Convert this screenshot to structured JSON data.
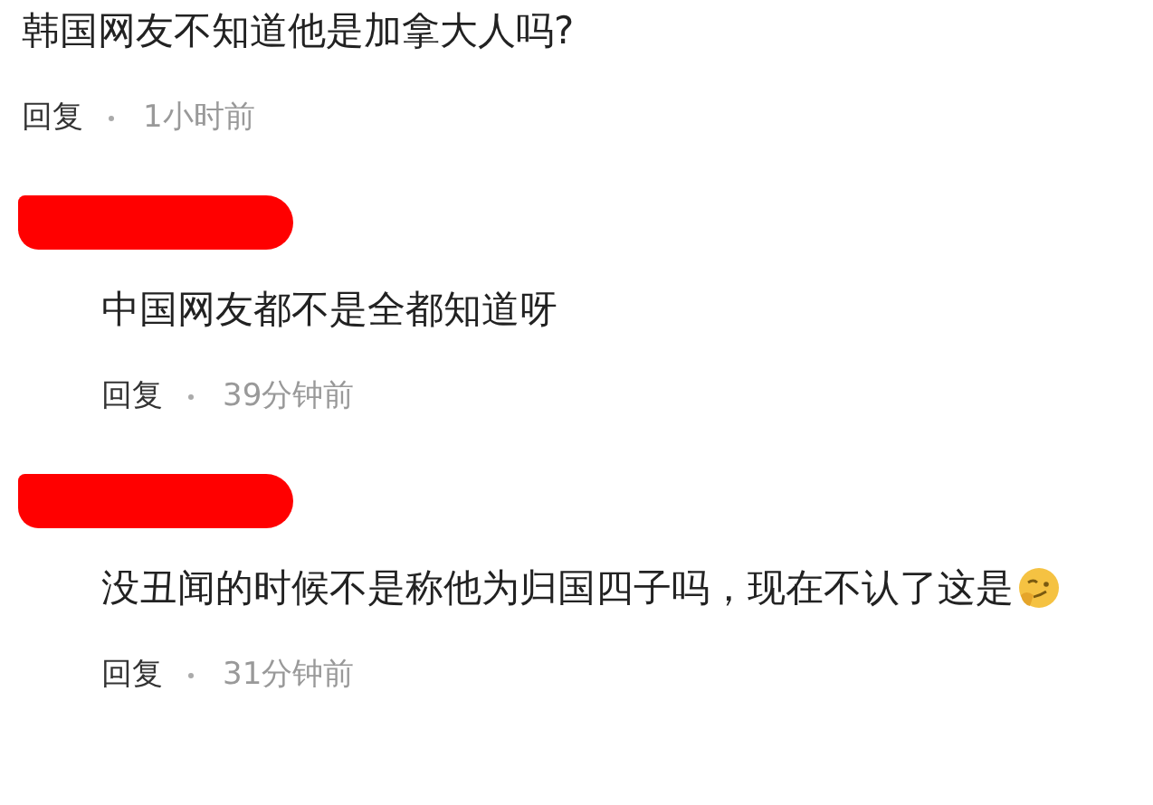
{
  "comment": {
    "text": "韩国网友不知道他是加拿大人吗?",
    "reply_label": "回复",
    "time": "1小时前"
  },
  "replies": [
    {
      "author_redacted": true,
      "text": "中国网友都不是全都知道呀",
      "reply_label": "回复",
      "time": "39分钟前"
    },
    {
      "author_redacted": true,
      "text": "没丑闻的时候不是称他为归国四子吗，现在不认了这是",
      "reply_label": "回复",
      "time": "31分钟前",
      "emoji": true
    }
  ]
}
